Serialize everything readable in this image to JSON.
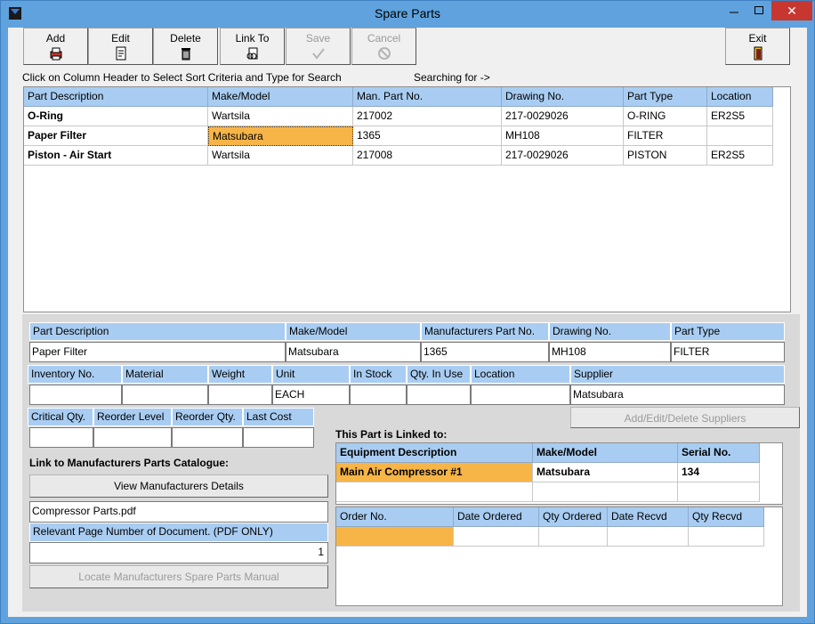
{
  "window": {
    "title": "Spare Parts"
  },
  "titlebar": {
    "minimize": "–",
    "maximize": "☐",
    "close": "✕"
  },
  "toolbar": {
    "add": "Add",
    "edit": "Edit",
    "delete": "Delete",
    "link_to": "Link To",
    "save": "Save",
    "cancel": "Cancel",
    "exit": "Exit"
  },
  "hints": {
    "sort": "Click on Column Header to Select Sort Criteria and Type for Search",
    "searching": "Searching for ->"
  },
  "parts_table": {
    "columns": [
      "Part Description",
      "Make/Model",
      "Man. Part No.",
      "Drawing No.",
      "Part Type",
      "Location"
    ],
    "rows": [
      [
        "O-Ring",
        "Wartsila",
        "217002",
        "217-0029026",
        "O-RING",
        "ER2S5"
      ],
      [
        "Paper Filter",
        "Matsubara",
        "1365",
        "MH108",
        "FILTER",
        ""
      ],
      [
        "Piston - Air Start",
        "Wartsila",
        "217008",
        "217-0029026",
        "PISTON",
        "ER2S5"
      ]
    ]
  },
  "detail": {
    "labels": {
      "part_description": "Part Description",
      "make_model": "Make/Model",
      "manufacturers_part_no": "Manufacturers Part No.",
      "drawing_no": "Drawing No.",
      "part_type": "Part Type",
      "inventory_no": "Inventory No.",
      "material": "Material",
      "weight": "Weight",
      "unit": "Unit",
      "in_stock": "In Stock",
      "qty_in_use": "Qty. In Use",
      "location": "Location",
      "supplier": "Supplier",
      "critical_qty": "Critical Qty.",
      "reorder_level": "Reorder Level",
      "reorder_qty": "Reorder Qty.",
      "last_cost": "Last Cost"
    },
    "values": {
      "part_description": "Paper Filter",
      "make_model": "Matsubara",
      "manufacturers_part_no": "1365",
      "drawing_no": "MH108",
      "part_type": "FILTER",
      "inventory_no": "",
      "material": "",
      "weight": "",
      "unit": "EACH",
      "in_stock": "",
      "qty_in_use": "",
      "location": "",
      "supplier": "Matsubara",
      "critical_qty": "",
      "reorder_level": "",
      "reorder_qty": "",
      "last_cost": ""
    },
    "add_edit_suppliers": "Add/Edit/Delete Suppliers"
  },
  "catalogue": {
    "heading": "Link to Manufacturers Parts Catalogue:",
    "view_button": "View Manufacturers Details",
    "document": "Compressor Parts.pdf",
    "page_label": "Relevant Page Number of Document. (PDF ONLY)",
    "page_value": "1",
    "locate_button": "Locate Manufacturers Spare Parts Manual"
  },
  "linked": {
    "heading": "This Part is Linked to:",
    "columns": [
      "Equipment Description",
      "Make/Model",
      "Serial No."
    ],
    "rows": [
      [
        "Main Air Compressor #1",
        "Matsubara",
        "134"
      ]
    ]
  },
  "orders": {
    "columns": [
      "Order No.",
      "Date Ordered",
      "Qty Ordered",
      "Date Recvd",
      "Qty Recvd"
    ]
  }
}
